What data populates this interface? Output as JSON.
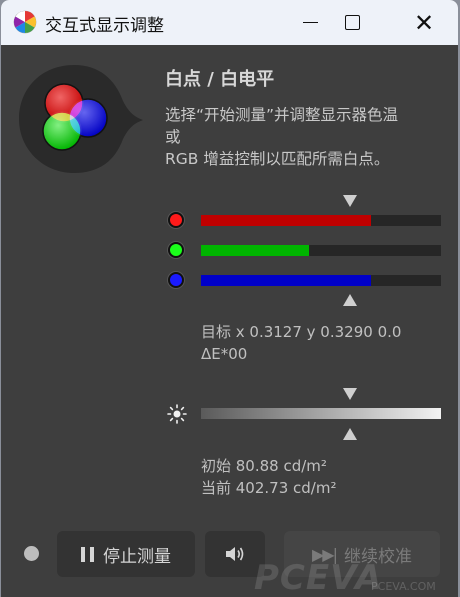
{
  "window": {
    "title": "交互式显示调整",
    "icons": {
      "app": "color-wheel-icon",
      "minimize": "minimize-icon",
      "maximize": "maximize-icon",
      "close": "close-icon"
    }
  },
  "section": {
    "heading": "白点 / 白电平",
    "description_line1": "选择“开始测量”并调整显示器色温",
    "description_line2": "或",
    "description_line3": "RGB 增益控制以匹配所需白点。"
  },
  "rgb_bars": [
    {
      "channel": "red",
      "level": 0.71,
      "dot_color": "#ff1a1a",
      "fill_color": "#c00000"
    },
    {
      "channel": "green",
      "level": 0.45,
      "dot_color": "#1aff1a",
      "fill_color": "#00b400"
    },
    {
      "channel": "blue",
      "level": 0.71,
      "dot_color": "#1a1aff",
      "fill_color": "#0000c8"
    }
  ],
  "target": {
    "line1": "目标 x 0.3127 y 0.3290 0.0",
    "line2": "ΔE*00"
  },
  "luminance": {
    "initial": "初始 80.88 cd/m²",
    "current": "当前 402.73 cd/m²"
  },
  "buttons": {
    "stop": "停止测量",
    "continue": "继续校准"
  },
  "watermark": {
    "brand": "PCEVA",
    "sub": "PCEVA.COM"
  }
}
